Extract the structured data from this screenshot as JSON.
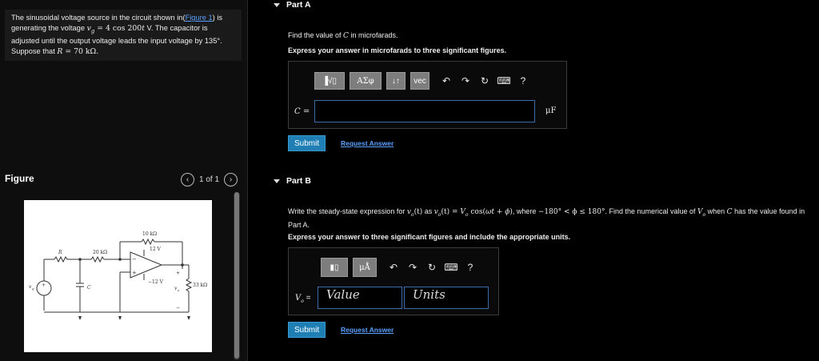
{
  "problem": {
    "text_1": "The sinusoidal voltage source in the circuit shown in(",
    "figure_link": "Figure 1",
    "text_2": ") is generating the voltage ",
    "vg_expr": "v",
    "vg_sub": "g",
    "vg_eq": " = 4 cos 200",
    "vg_t": "t",
    "vg_unit": " V. The capacitor is adjusted until the output voltage leads the input voltage by 135°. Suppose that ",
    "r_sym": "R",
    "r_val": " = 70 kΩ."
  },
  "figure": {
    "title": "Figure",
    "pager": "1 of 1",
    "labels": {
      "r": "R",
      "r20": "20 kΩ",
      "r10": "10 kΩ",
      "v12p": "12 V",
      "v12n": "−12 V",
      "r33": "33 kΩ",
      "c": "C",
      "vg": "v",
      "vg_sub": "g",
      "vo": "v",
      "vo_sub": "o",
      "plus": "+",
      "minus": "−"
    }
  },
  "partA": {
    "label": "Part A",
    "q_pre": "Find the value of ",
    "q_sym": "C",
    "q_post": " in microfarads.",
    "instruction": "Express your answer in microfarads to three significant figures.",
    "toolbar": {
      "templates": "▐√▯",
      "greek": "ΑΣφ",
      "sort": "↓↑",
      "vec": "vec",
      "help": "?"
    },
    "var_label": "C =",
    "unit": "μF",
    "input_value": "",
    "submit": "Submit",
    "request": "Request Answer"
  },
  "partB": {
    "label": "Part B",
    "q1": "Write the steady-state expression for ",
    "q2": " as ",
    "q3": ", where ",
    "q4": ". Find the numerical value of ",
    "q5": " when ",
    "q6": " has the value found in Part A.",
    "vo_t": "v",
    "vo_sub": "o",
    "arg_t": "(t)",
    "expr_rhs": "V",
    "expr_cos": " cos(",
    "expr_omega": "ωt",
    "expr_plus": " + ",
    "expr_phi": "ϕ",
    "expr_close": ")",
    "range": "−180° < ϕ ≤ 180°",
    "vo_cap": "V",
    "c_sym": "C",
    "instruction": "Express your answer to three significant figures and include the appropriate units.",
    "toolbar": {
      "templates": "▮▯",
      "units": "μÅ",
      "help": "?"
    },
    "var_label": "V",
    "var_sub": "o",
    "var_eq": " =",
    "value_placeholder": "Value",
    "units_placeholder": "Units",
    "submit": "Submit",
    "request": "Request Answer"
  }
}
